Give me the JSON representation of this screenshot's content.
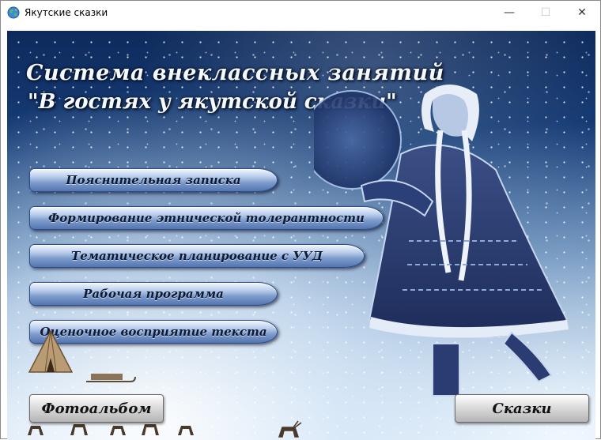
{
  "window": {
    "title": "Якутские сказки",
    "controls": {
      "minimize": "—",
      "maximize": "☐",
      "close": "✕"
    }
  },
  "scene": {
    "title_line1": "Система внеклассных занятий",
    "title_line2": "\"В гостях у якутской сказки\""
  },
  "menu": [
    {
      "label": "Пояснительная записка"
    },
    {
      "label": "Формирование этнической толерантности"
    },
    {
      "label": "Тематическое планирование с УУД"
    },
    {
      "label": "Рабочая программа"
    },
    {
      "label": "Оценочное восприятие текста"
    }
  ],
  "bottom": {
    "photo_label": "Фотоальбом",
    "tales_label": "Сказки"
  },
  "icons": {
    "app": "globe-icon",
    "minimize": "minimize-icon",
    "maximize": "maximize-icon",
    "close": "close-icon"
  }
}
